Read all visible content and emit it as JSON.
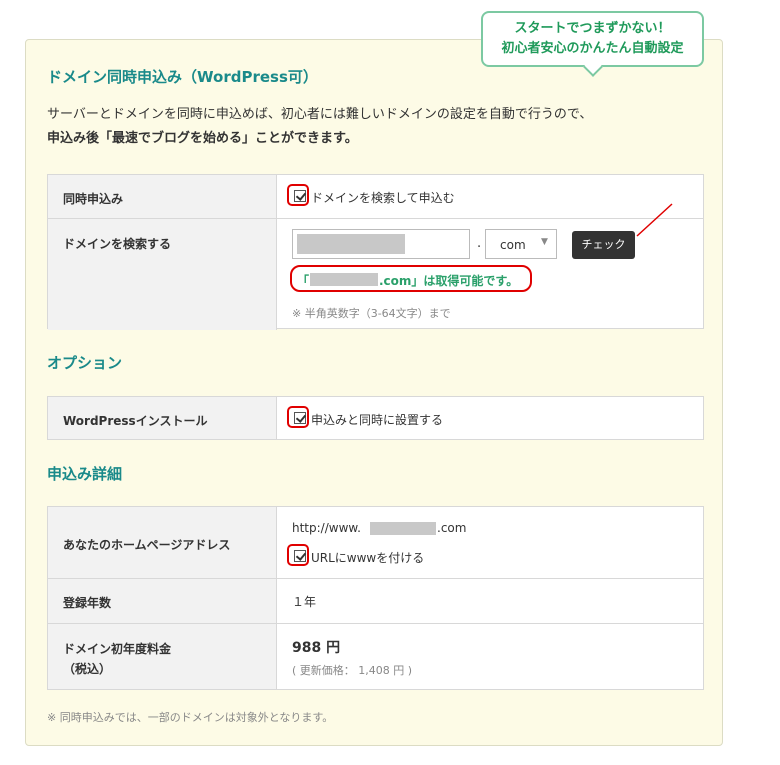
{
  "bubble": {
    "line1": "スタートでつまずかない！",
    "line2": "初心者安心のかんたん自動設定"
  },
  "section": {
    "title": "ドメイン同時申込み（WordPress可）",
    "intro1": "サーバーとドメインを同時に申込めば、初心者には難しいドメインの設定を自動で行うので、",
    "intro2": "申込み後「最速でブログを始める」ことができます。"
  },
  "domain_table": {
    "simultaneous_label": "同時申込み",
    "simultaneous_checkbox_label": "ドメインを検索して申込む",
    "search_label": "ドメインを検索する",
    "dot": ".",
    "tld_value": "com",
    "check_button": "チェック",
    "availability_prefix": "「",
    "availability_suffix": ".com」は取得可能です。",
    "hint": "※ 半角英数字（3-64文字）まで"
  },
  "options": {
    "title": "オプション",
    "wp_label": "WordPressインストール",
    "wp_checkbox_label": "申込みと同時に設置する"
  },
  "details": {
    "title": "申込み詳細",
    "address_label": "あなたのホームページアドレス",
    "url_prefix": "http://www.",
    "url_suffix": ".com",
    "www_checkbox_label": "URLにwwwを付ける",
    "years_label": "登録年数",
    "years_value": "１年",
    "fee_label_line1": "ドメイン初年度料金",
    "fee_label_line2": "（税込）",
    "fee_value": "988 円",
    "renewal": "( 更新価格： 1,408 円 )"
  },
  "footnote": "※ 同時申込みでは、一部のドメインは対象外となります。",
  "colors": {
    "accent": "#1a8a8a",
    "available": "#2aa06a",
    "highlight": "#e00000",
    "panel_bg": "#fdfbe6"
  }
}
